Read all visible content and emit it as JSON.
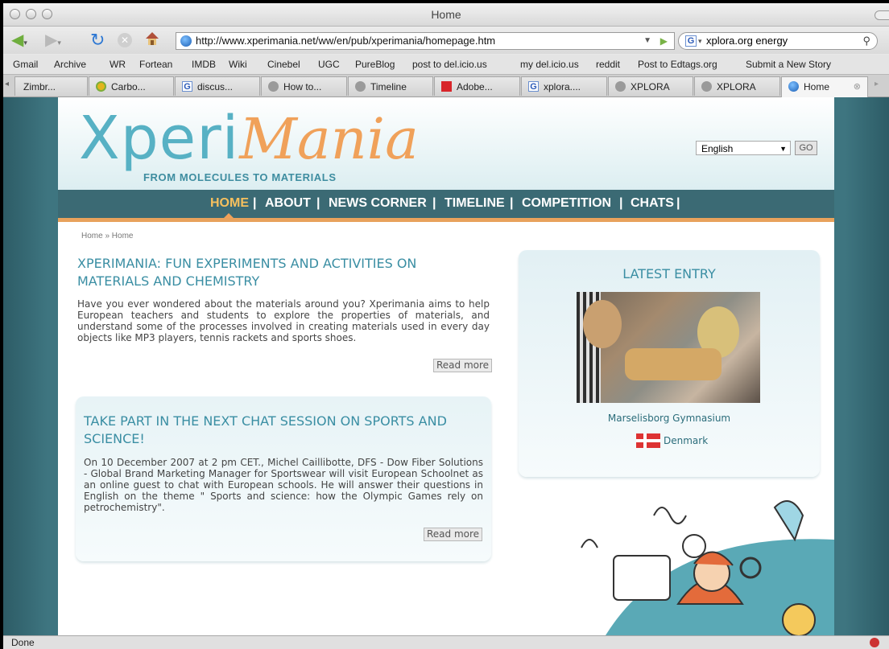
{
  "window": {
    "title": "Home"
  },
  "toolbar": {
    "url": "http://www.xperimania.net/ww/en/pub/xperimania/homepage.htm",
    "search_value": "xplora.org energy",
    "search_engine_badge": "G"
  },
  "bookmarks": [
    "Gmail",
    "Archive",
    "WR",
    "Fortean",
    "IMDB",
    "Wiki",
    "Cinebel",
    "UGC",
    "PureBlog",
    "post to del.icio.us",
    "my del.icio.us",
    "reddit",
    "Post to Edtags.org",
    "Submit a New Story"
  ],
  "tabs": [
    {
      "label": "Zimbr...",
      "icon": "zimbra-icon"
    },
    {
      "label": "Carbo...",
      "icon": "carbon-icon"
    },
    {
      "label": "discus...",
      "icon": "google-icon"
    },
    {
      "label": "How to...",
      "icon": "globe-icon"
    },
    {
      "label": "Timeline",
      "icon": "globe-icon"
    },
    {
      "label": "Adobe...",
      "icon": "adobe-icon"
    },
    {
      "label": "xplora....",
      "icon": "google-icon"
    },
    {
      "label": "XPLORA",
      "icon": "globe-icon"
    },
    {
      "label": "XPLORA",
      "icon": "globe-icon"
    },
    {
      "label": "Home",
      "icon": "globe-icon"
    }
  ],
  "site": {
    "logo_left": "Xperi",
    "logo_right": "Mania",
    "tagline": "FROM MOLECULES TO MATERIALS",
    "language": "English",
    "go_label": "GO",
    "nav": [
      "HOME",
      "ABOUT",
      "NEWS CORNER",
      "TIMELINE",
      "COMPETITION",
      "CHATS"
    ],
    "nav_separator": "|",
    "breadcrumb": "Home » Home"
  },
  "articles": [
    {
      "title": "XPERIMANIA: FUN EXPERIMENTS AND ACTIVITIES ON MATERIALS AND CHEMISTRY",
      "body": "Have you ever wondered about the materials around you? Xperimania aims to help European teachers and students to explore the properties of materials, and understand some of the processes involved in creating materials used in every day objects like MP3 players, tennis rackets and sports shoes.",
      "read_more": "Read more"
    },
    {
      "title": "TAKE PART IN THE NEXT CHAT SESSION ON SPORTS AND SCIENCE!",
      "body": "On 10 December 2007 at 2 pm CET., Michel Caillibotte, DFS - Dow Fiber Solutions - Global Brand Marketing Manager for Sportswear will visit European Schoolnet as an online guest to chat with European schools. He will answer their questions in English on the theme \" Sports and science: how the Olympic Games rely on petrochemistry\".",
      "read_more": "Read more"
    }
  ],
  "latest_entry": {
    "heading": "LATEST ENTRY",
    "school": "Marselisborg Gymnasium",
    "country": "Denmark"
  },
  "statusbar": {
    "text": "Done"
  },
  "colors": {
    "accent_teal": "#3a8ea3",
    "accent_orange": "#f0a15a",
    "nav_bg": "#3b6a74",
    "nav_current": "#f6c05e"
  }
}
